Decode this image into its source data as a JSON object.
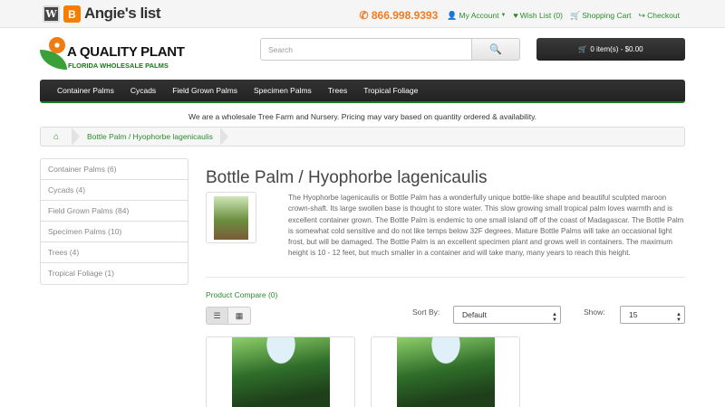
{
  "topbar": {
    "angies_label": "Angie's list",
    "phone": "866.998.9393",
    "my_account": "My Account",
    "wish_list": "Wish List (0)",
    "shopping_cart": "Shopping Cart",
    "checkout": "Checkout"
  },
  "logo": {
    "line1": "A QUALITY PLANT",
    "line2": "FLORIDA WHOLESALE PALMS"
  },
  "search": {
    "placeholder": "Search"
  },
  "cart": {
    "label": "0 item(s) - $0.00"
  },
  "menu": {
    "items": [
      "Container Palms",
      "Cycads",
      "Field Grown Palms",
      "Specimen Palms",
      "Trees",
      "Tropical Foliage"
    ]
  },
  "notice": "We are a wholesale Tree Farm and Nursery. Pricing may vary based on quantity ordered & availability.",
  "breadcrumb": {
    "current": "Bottle Palm / Hyophorbe lagenicaulis"
  },
  "categories": [
    "Container Palms (6)",
    "Cycads (4)",
    "Field Grown Palms (84)",
    "Specimen Palms (10)",
    "Trees (4)",
    "Tropical Foliage (1)"
  ],
  "page": {
    "title": "Bottle Palm / Hyophorbe lagenicaulis",
    "description": "The Hyophorbe lagenicaulis or Bottle Palm has a wonderfully unique bottle-like shape and beautiful sculpted maroon crown-shaft. Its large swollen base is thought to store water. This slow growing small tropical palm loves warmth and is excellent container grown. The Bottle Palm is endemic to one small island off of the coast of Madagascar. The Bottle Palm is somewhat cold sensitive and do not like temps below 32F degrees. Mature Bottle Palms will take an occasional light frost, but will be damaged. The Bottle Palm is an excellent specimen plant and grows well in containers. The maximum height is 10 - 12 feet, but much smaller in a container and will take many, many years to reach this height."
  },
  "toolbar": {
    "product_compare": "Product Compare (0)",
    "sort_by_label": "Sort By:",
    "sort_value": "Default",
    "show_label": "Show:",
    "show_value": "15"
  },
  "colors": {
    "accent_green": "#2e8b2e",
    "phone_orange": "#f47b20",
    "menu_dark": "#2a2a2a"
  }
}
